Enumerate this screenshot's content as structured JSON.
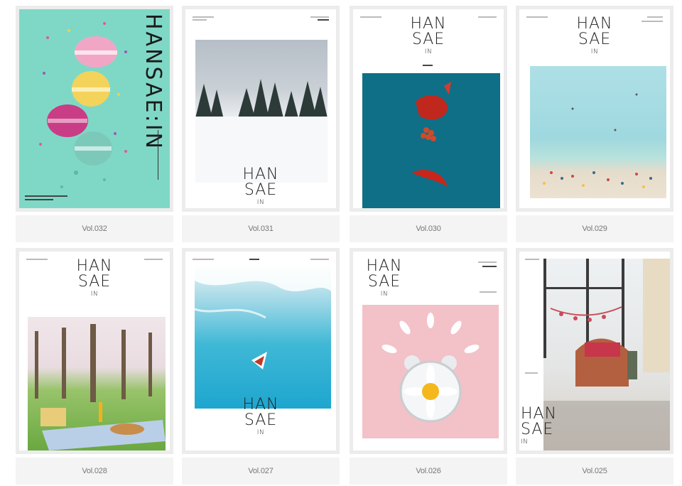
{
  "gallery": {
    "items": [
      {
        "label": "Vol.032"
      },
      {
        "label": "Vol.031"
      },
      {
        "label": "Vol.030"
      },
      {
        "label": "Vol.029"
      },
      {
        "label": "Vol.028"
      },
      {
        "label": "Vol.027"
      },
      {
        "label": "Vol.026"
      },
      {
        "label": "Vol.025"
      }
    ]
  },
  "logo": {
    "line1": "HAN",
    "line2": "SAE",
    "line3": "IN",
    "vertical": "HANSAE:IN"
  },
  "colors": {
    "frame": "#ececec",
    "caption_bg": "#f4f4f4",
    "caption_text": "#777777"
  }
}
